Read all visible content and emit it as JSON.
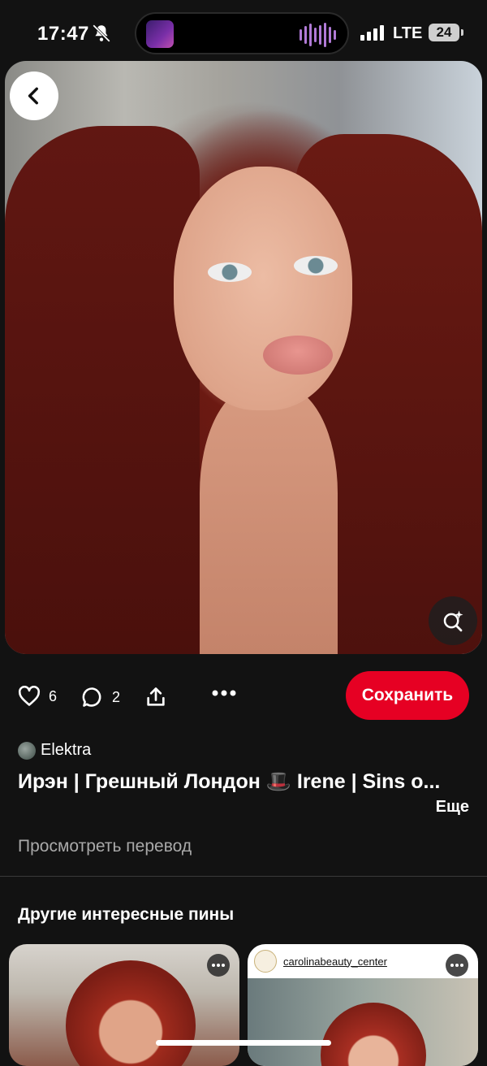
{
  "status_bar": {
    "time": "17:47",
    "network": "LTE",
    "battery": "24",
    "icons": [
      "bell-slash-icon",
      "signal-icon",
      "battery-icon"
    ]
  },
  "pin": {
    "likes": "6",
    "comments": "2",
    "save_label": "Сохранить",
    "author": "Elektra",
    "title": "Ирэн | Грешный Лондон 🎩 Irene | Sins o...",
    "more_label": "Еще",
    "translate_label": "Просмотреть перевод"
  },
  "related": {
    "heading": "Другие интересные пины",
    "cards": [
      {
        "account": ""
      },
      {
        "account": "carolinabeauty_center"
      }
    ]
  },
  "colors": {
    "accent": "#e60023",
    "background": "#121212"
  }
}
